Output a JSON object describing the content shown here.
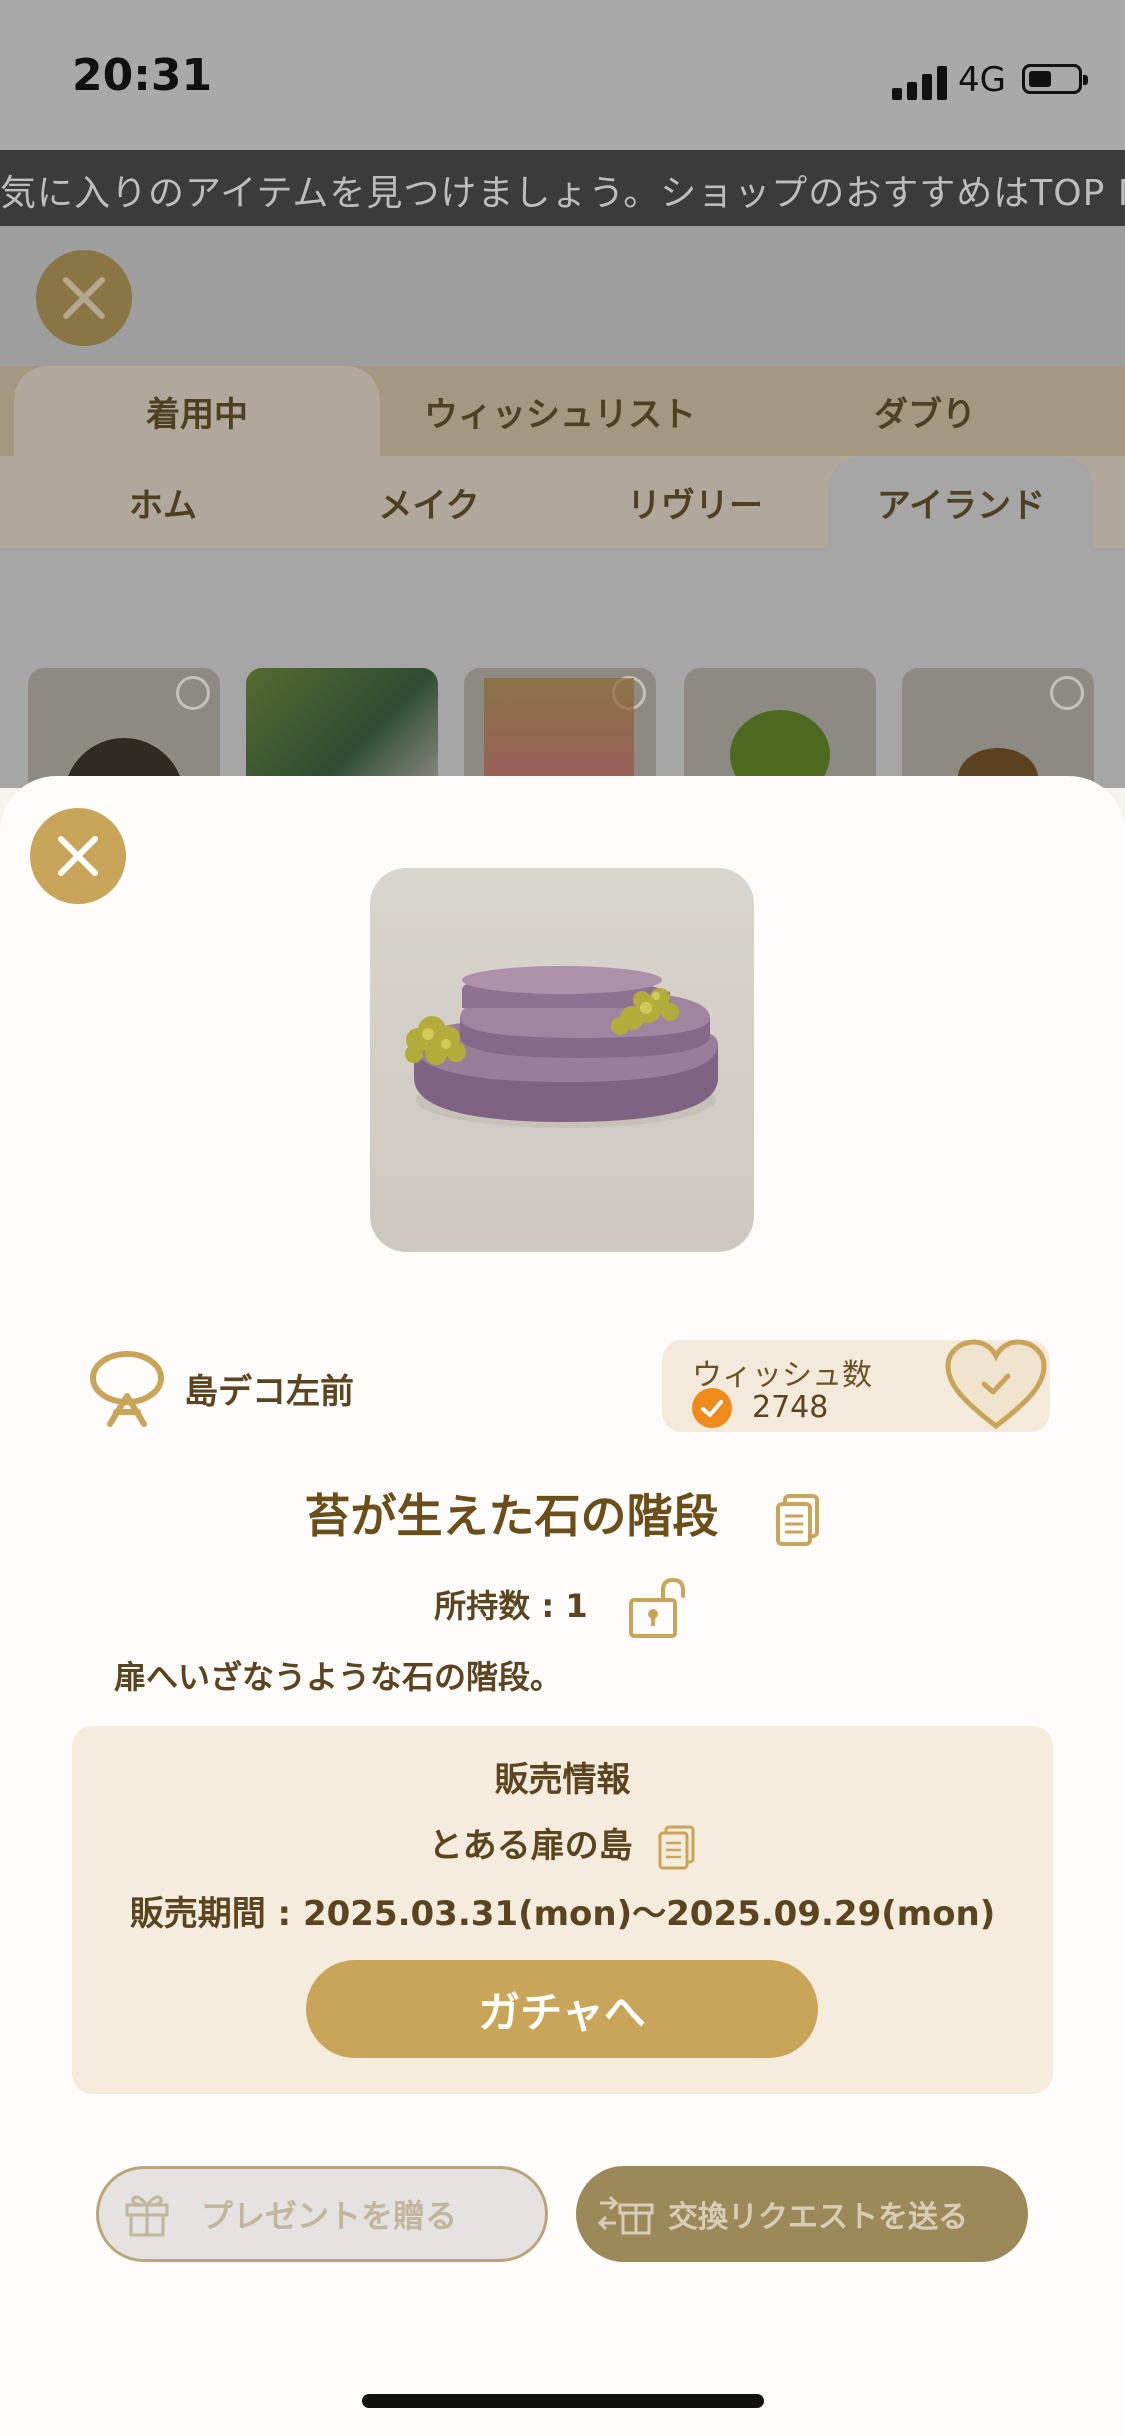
{
  "status_bar": {
    "time": "20:31",
    "network": "4G"
  },
  "ticker": {
    "text": "気に入りのアイテムを見つけましょう。ショップのおすすめはTOP NEW"
  },
  "tabs_primary": [
    {
      "label": "着用中",
      "active": true
    },
    {
      "label": "ウィッシュリスト",
      "active": false
    },
    {
      "label": "ダブり",
      "active": false
    }
  ],
  "tabs_secondary": [
    {
      "label": "ホム",
      "active": false
    },
    {
      "label": "メイク",
      "active": false
    },
    {
      "label": "リヴリー",
      "active": false
    },
    {
      "label": "アイランド",
      "active": true
    }
  ],
  "item": {
    "category": "島デコ左前",
    "name": "苔が生えた石の階段",
    "owned": "所持数 : 1",
    "description": "扉へいざなうような石の階段。"
  },
  "wish": {
    "title": "ウィッシュ数",
    "count": "2748"
  },
  "sale": {
    "title": "販売情報",
    "shop": "とある扉の島",
    "period": "販売期間 : 2025.03.31(mon)〜2025.09.29(mon)"
  },
  "actions": {
    "gacha": "ガチャへ",
    "present": "プレゼントを贈る",
    "trade": "交換リクエストを送る"
  },
  "colors": {
    "accent_gold": "#c9a55a",
    "text_brown": "#5a4520",
    "sale_bg": "#f6ecdd",
    "wish_orange": "#ef8a1c"
  }
}
